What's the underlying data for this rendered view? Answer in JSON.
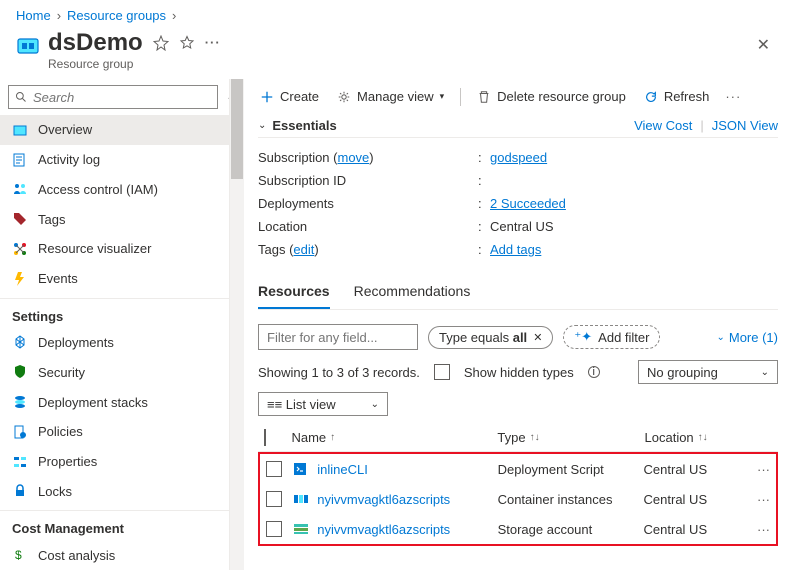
{
  "breadcrumb": {
    "home": "Home",
    "rg": "Resource groups"
  },
  "header": {
    "title": "dsDemo",
    "subtitle": "Resource group"
  },
  "search": {
    "placeholder": "Search"
  },
  "nav": {
    "overview": "Overview",
    "activity": "Activity log",
    "iam": "Access control (IAM)",
    "tags": "Tags",
    "rv": "Resource visualizer",
    "events": "Events",
    "settings_hdr": "Settings",
    "deployments": "Deployments",
    "security": "Security",
    "stacks": "Deployment stacks",
    "policies": "Policies",
    "properties": "Properties",
    "locks": "Locks",
    "cost_hdr": "Cost Management",
    "cost": "Cost analysis"
  },
  "toolbar": {
    "create": "Create",
    "manage": "Manage view",
    "delete": "Delete resource group",
    "refresh": "Refresh"
  },
  "essentials": {
    "title": "Essentials",
    "view_cost": "View Cost",
    "json_view": "JSON View",
    "rows": {
      "sub_lbl": "Subscription",
      "sub_move": "move",
      "sub_val": "godspeed",
      "subid_lbl": "Subscription ID",
      "subid_val": "",
      "dep_lbl": "Deployments",
      "dep_val": "2 Succeeded",
      "loc_lbl": "Location",
      "loc_val": "Central US",
      "tags_lbl": "Tags",
      "tags_edit": "edit",
      "tags_val": "Add tags"
    }
  },
  "tabs": {
    "resources": "Resources",
    "recs": "Recommendations"
  },
  "filters": {
    "placeholder": "Filter for any field...",
    "type_chip_pre": "Type equals ",
    "type_chip_bold": "all",
    "add_filter": "Add filter",
    "more": "More (1)",
    "showing": "Showing 1 to 3 of 3 records.",
    "hidden": "Show hidden types",
    "no_group": "No grouping",
    "list_view": "List view"
  },
  "table": {
    "cols": {
      "name": "Name",
      "type": "Type",
      "loc": "Location"
    },
    "rows": [
      {
        "name": "inlineCLI",
        "type": "Deployment Script",
        "loc": "Central US",
        "icon": "script"
      },
      {
        "name": "nyivvmvagktl6azscripts",
        "type": "Container instances",
        "loc": "Central US",
        "icon": "container"
      },
      {
        "name": "nyivvmvagktl6azscripts",
        "type": "Storage account",
        "loc": "Central US",
        "icon": "storage"
      }
    ]
  }
}
